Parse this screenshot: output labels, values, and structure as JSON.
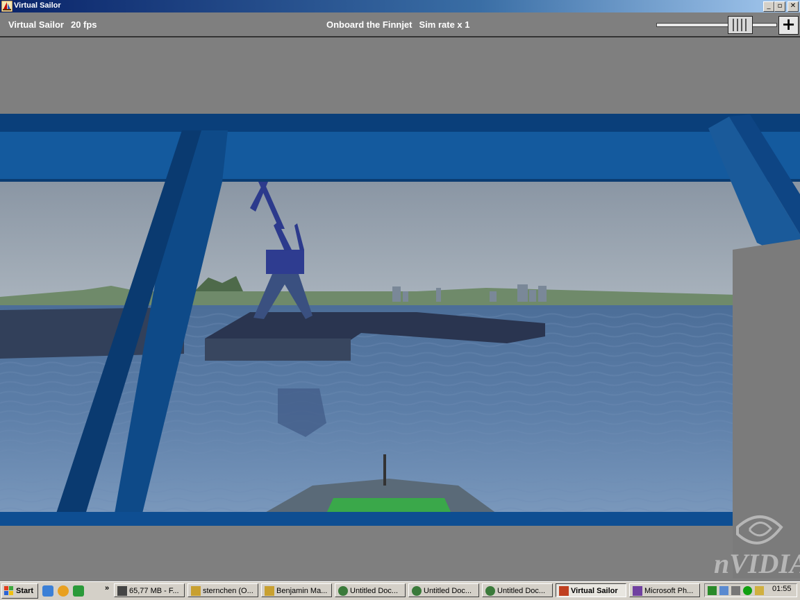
{
  "window": {
    "title": "Virtual Sailor",
    "minimize_glyph": "_",
    "maximize_glyph": "▫",
    "close_glyph": "✕"
  },
  "hud": {
    "app_name": "Virtual Sailor",
    "fps": "20 fps",
    "vessel": "Onboard the Finnjet",
    "sim_rate": "Sim rate x 1",
    "zoom_plus": "+"
  },
  "watermark": "nVIDIA",
  "taskbar": {
    "start": "Start",
    "chevron": "»",
    "tasks": [
      {
        "label": "65,77 MB - F...",
        "active": false
      },
      {
        "label": "sternchen (O...",
        "active": false
      },
      {
        "label": "Benjamin Ma...",
        "active": false
      },
      {
        "label": "Untitled Doc...",
        "active": false
      },
      {
        "label": "Untitled Doc...",
        "active": false
      },
      {
        "label": "Untitled Doc...",
        "active": false
      },
      {
        "label": "Virtual Sailor",
        "active": true
      },
      {
        "label": "Microsoft Ph...",
        "active": false
      }
    ],
    "clock": "01:55"
  },
  "icons": {
    "app": "sailboat-icon",
    "start": "windows-logo-icon",
    "quicklaunch": [
      "internet-explorer-icon",
      "media-player-icon",
      "show-desktop-icon"
    ]
  }
}
